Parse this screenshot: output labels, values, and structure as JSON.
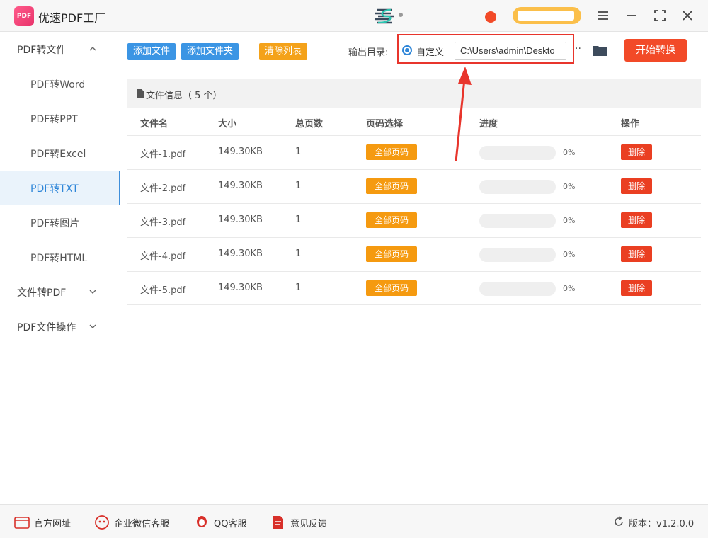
{
  "app": {
    "logo_text": "PDF",
    "title": "优速PDF工厂"
  },
  "colors": {
    "accent": "#3b95e4",
    "danger": "#f24a28",
    "warning": "#f59a10",
    "active_text": "#2f86d8"
  },
  "sidebar": {
    "items": [
      {
        "label": "PDF转文件",
        "type": "group",
        "expanded": true
      },
      {
        "label": "PDF转Word",
        "type": "sub"
      },
      {
        "label": "PDF转PPT",
        "type": "sub"
      },
      {
        "label": "PDF转Excel",
        "type": "sub"
      },
      {
        "label": "PDF转TXT",
        "type": "sub",
        "active": true
      },
      {
        "label": "PDF转图片",
        "type": "sub"
      },
      {
        "label": "PDF转HTML",
        "type": "sub"
      },
      {
        "label": "文件转PDF",
        "type": "group",
        "expanded": false
      },
      {
        "label": "PDF文件操作",
        "type": "group",
        "expanded": false
      }
    ]
  },
  "toolbar": {
    "add_file": "添加文件",
    "add_folder": "添加文件夹",
    "clear_list": "清除列表",
    "output_label": "输出目录:",
    "custom_label": "自定义",
    "output_path": "C:\\Users\\admin\\Deskto",
    "more": "··",
    "start": "开始转换"
  },
  "file_panel": {
    "title": "文件信息（ 5 个）",
    "headers": {
      "name": "文件名",
      "size": "大小",
      "pages": "总页数",
      "page_select": "页码选择",
      "progress": "进度",
      "action": "操作"
    },
    "rows": [
      {
        "name": "文件-1.pdf",
        "size": "149.30KB",
        "pages": "1",
        "page_select": "全部页码",
        "progress": 0,
        "progress_label": "0%",
        "action": "删除"
      },
      {
        "name": "文件-2.pdf",
        "size": "149.30KB",
        "pages": "1",
        "page_select": "全部页码",
        "progress": 0,
        "progress_label": "0%",
        "action": "删除"
      },
      {
        "name": "文件-3.pdf",
        "size": "149.30KB",
        "pages": "1",
        "page_select": "全部页码",
        "progress": 0,
        "progress_label": "0%",
        "action": "删除"
      },
      {
        "name": "文件-4.pdf",
        "size": "149.30KB",
        "pages": "1",
        "page_select": "全部页码",
        "progress": 0,
        "progress_label": "0%",
        "action": "删除"
      },
      {
        "name": "文件-5.pdf",
        "size": "149.30KB",
        "pages": "1",
        "page_select": "全部页码",
        "progress": 0,
        "progress_label": "0%",
        "action": "删除"
      }
    ]
  },
  "footer": {
    "website": "官方网址",
    "wechat": "企业微信客服",
    "qq": "QQ客服",
    "feedback": "意见反馈",
    "version": "版本：v1.2.0.0"
  }
}
